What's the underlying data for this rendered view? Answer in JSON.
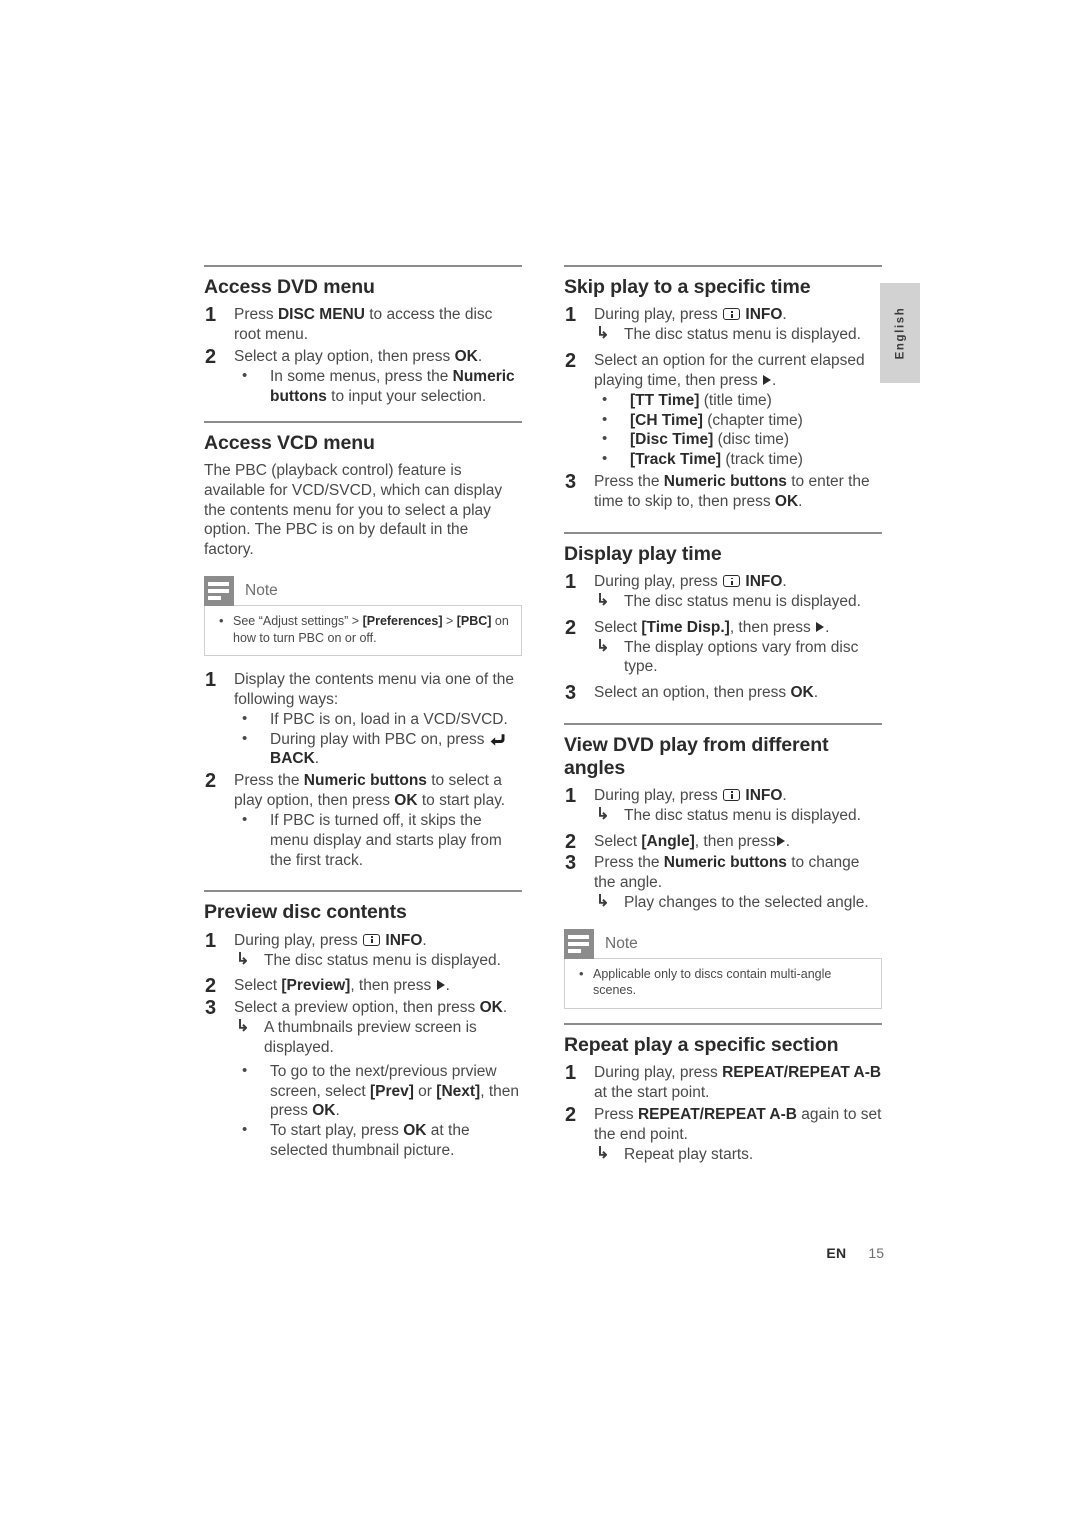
{
  "page": {
    "language_tab": "English",
    "footer_lang_code": "EN",
    "footer_page_number": "15"
  },
  "icons": {
    "info": "info-icon",
    "play_right": "play-right-icon",
    "back_return": "back-return-icon",
    "note": "note-icon",
    "result_arrow": "result-arrow-icon",
    "bullet": "bullet-icon"
  },
  "colors": {
    "rule": "#8c8c8c",
    "heading": "#2b2b2b",
    "body": "#4a4a4a",
    "note_icon_bg": "#8c8c8c",
    "note_border": "#cfcfcf",
    "lang_tab_bg": "#d2d2d2"
  },
  "left_column": {
    "sections": [
      {
        "title": "Access DVD menu",
        "steps": [
          {
            "pre": "Press ",
            "bold": "DISC MENU",
            "post": " to access the disc root menu."
          },
          {
            "pre": "Select a play option, then press ",
            "bold": "OK",
            "post": "."
          }
        ],
        "step2_bullets": [
          {
            "pre": "In some menus, press the ",
            "bold": "Numeric buttons",
            "post": " to input your selection."
          }
        ]
      },
      {
        "title": "Access VCD menu",
        "paragraph": "The PBC (playback control) feature is available for VCD/SVCD, which can display the contents menu for you to select a play option. The PBC is on by default in the factory.",
        "note": {
          "label": "Note",
          "items": [
            {
              "pre": "See “Adjust settings” > ",
              "b1": "[Preferences]",
              "mid": " > ",
              "b2": "[PBC]",
              "post": " on how to turn PBC on or off."
            }
          ]
        },
        "steps": [
          {
            "text": "Display the contents menu via one of the following ways:"
          },
          {
            "pre": "Press the ",
            "bold": "Numeric buttons",
            "mid": " to select a play option, then press ",
            "bold2": "OK",
            "post": " to start play."
          }
        ],
        "step1_bullets": [
          {
            "text": "If PBC is on, load in a VCD/SVCD."
          },
          {
            "pre": "During play with PBC on, press ",
            "icon": "back-return-icon",
            "bold": "BACK",
            "post": "."
          }
        ],
        "step2_bullets": [
          {
            "text": "If PBC is turned off, it skips the menu display and starts play from the first track."
          }
        ]
      },
      {
        "title": "Preview disc contents",
        "steps": [
          {
            "pre": "During play, press ",
            "icon": "info-icon",
            "bold": "INFO",
            "post": "."
          },
          {
            "pre": "Select ",
            "bold": "[Preview]",
            "post": ", then press ",
            "icon_end": "play-right-icon",
            "tail": "."
          },
          {
            "pre": "Select a preview option, then press ",
            "bold": "OK",
            "post": "."
          }
        ],
        "step1_results": [
          {
            "text": "The disc status menu is displayed."
          }
        ],
        "step3_results": [
          {
            "text": "A thumbnails preview screen is displayed."
          }
        ],
        "step3_bullets": [
          {
            "pre": "To go to the next/previous prview screen, select ",
            "b1": "[Prev]",
            "mid": " or ",
            "b2": "[Next]",
            "mid2": ", then press ",
            "b3": "OK",
            "post": "."
          },
          {
            "pre": "To start play, press ",
            "b1": "OK",
            "post": " at the selected thumbnail picture."
          }
        ]
      }
    ]
  },
  "right_column": {
    "sections": [
      {
        "title": "Skip play to a specific time",
        "steps": [
          {
            "pre": "During play, press ",
            "icon": "info-icon",
            "bold": "INFO",
            "post": "."
          },
          {
            "pre": "Select an option for the current elapsed playing time, then press ",
            "icon_end": "play-right-icon",
            "tail": "."
          },
          {
            "pre": "Press the ",
            "bold": "Numeric buttons",
            "mid": " to enter the time to skip to, then press ",
            "bold2": "OK",
            "post": "."
          }
        ],
        "step1_results": [
          {
            "text": "The disc status menu is displayed."
          }
        ],
        "step2_bullets": [
          {
            "bold": "[TT Time]",
            "post": " (title time)"
          },
          {
            "bold": "[CH Time]",
            "post": " (chapter time)"
          },
          {
            "bold": "[Disc Time]",
            "post": " (disc time)"
          },
          {
            "bold": "[Track Time]",
            "post": " (track time)"
          }
        ]
      },
      {
        "title": "Display play time",
        "steps": [
          {
            "pre": "During play, press ",
            "icon": "info-icon",
            "bold": "INFO",
            "post": "."
          },
          {
            "pre": "Select ",
            "bold": "[Time Disp.]",
            "post": ", then press ",
            "icon_end": "play-right-icon",
            "tail": "."
          },
          {
            "pre": "Select an option, then press ",
            "bold": "OK",
            "post": "."
          }
        ],
        "step1_results": [
          {
            "text": "The disc status menu is displayed."
          }
        ],
        "step2_results": [
          {
            "text": "The display options vary from disc type."
          }
        ]
      },
      {
        "title": "View DVD play from different angles",
        "steps": [
          {
            "pre": "During play, press ",
            "icon": "info-icon",
            "bold": "INFO",
            "post": "."
          },
          {
            "pre": "Select ",
            "bold": "[Angle]",
            "post": ", then press",
            "icon_end": "play-right-icon",
            "tail": "."
          },
          {
            "pre": "Press the ",
            "bold": "Numeric buttons",
            "post": " to change the angle."
          }
        ],
        "step1_results": [
          {
            "text": "The disc status menu is displayed."
          }
        ],
        "step3_results": [
          {
            "text": "Play changes to the selected angle."
          }
        ],
        "note": {
          "label": "Note",
          "items": [
            {
              "text": "Applicable only to discs contain multi-angle scenes."
            }
          ]
        }
      },
      {
        "title": "Repeat play a specific section",
        "steps": [
          {
            "pre": "During play, press ",
            "bold": "REPEAT/REPEAT A-B",
            "post": " at the start point."
          },
          {
            "pre": "Press ",
            "bold": "REPEAT/REPEAT A-B",
            "post": " again to set the end point."
          }
        ],
        "step2_results": [
          {
            "text": "Repeat play starts."
          }
        ]
      }
    ]
  }
}
